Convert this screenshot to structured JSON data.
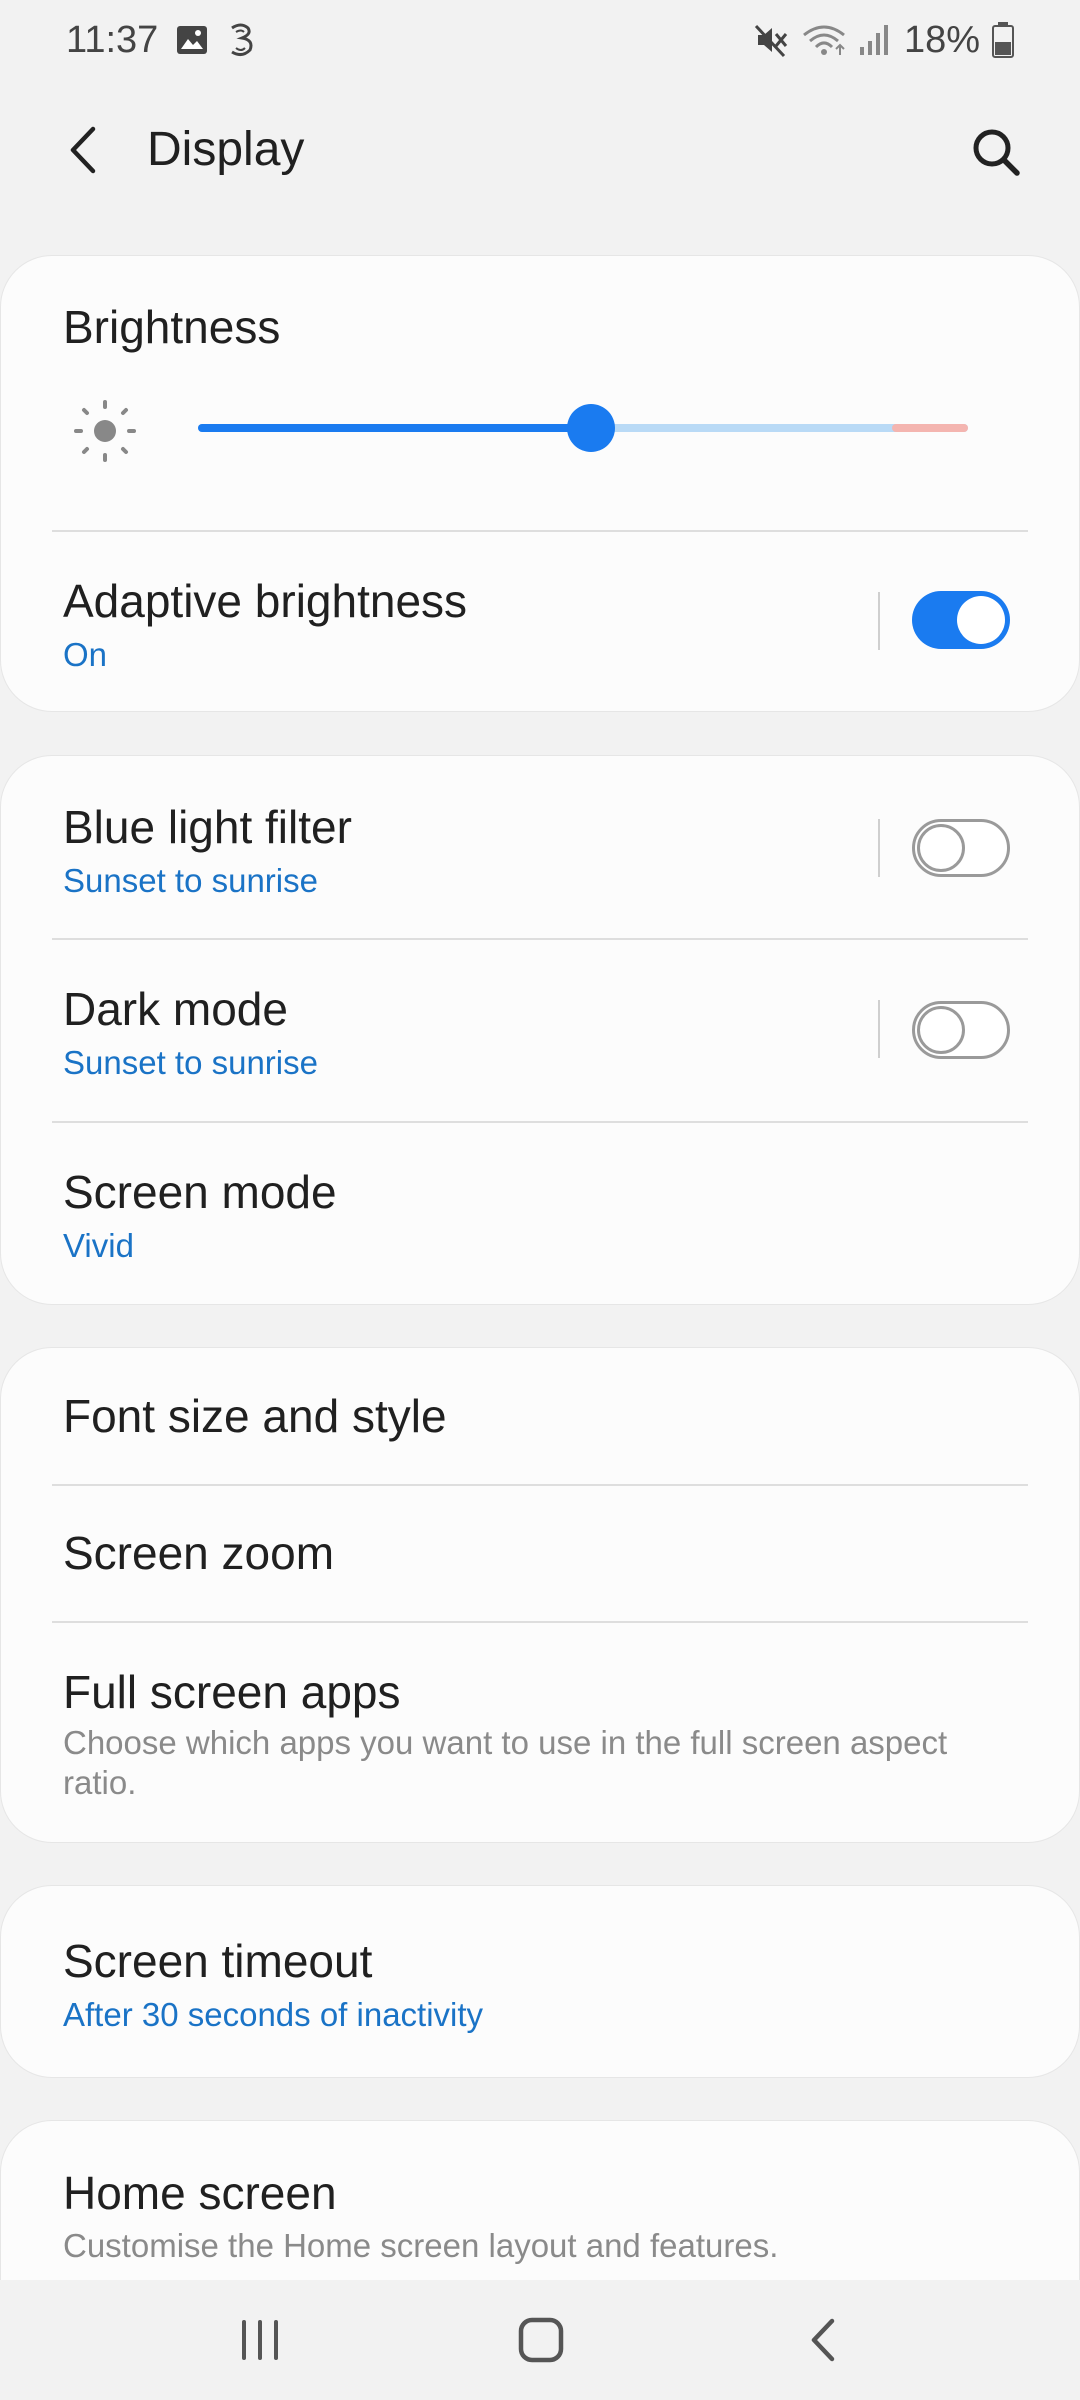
{
  "status_bar": {
    "time": "11:37",
    "battery": "18%",
    "icons": [
      "image-icon",
      "three-network-icon",
      "mute-icon",
      "wifi-icon",
      "signal-icon",
      "battery-icon"
    ]
  },
  "header": {
    "title": "Display",
    "back_icon": "chevron-left-icon",
    "search_icon": "search-icon"
  },
  "brightness": {
    "title": "Brightness",
    "icon": "sun-icon",
    "level": 0.51
  },
  "adaptive_brightness": {
    "title": "Adaptive brightness",
    "status": "On",
    "enabled": true
  },
  "blue_light_filter": {
    "title": "Blue light filter",
    "status": "Sunset to sunrise",
    "enabled": false
  },
  "dark_mode": {
    "title": "Dark mode",
    "status": "Sunset to sunrise",
    "enabled": false
  },
  "screen_mode": {
    "title": "Screen mode",
    "status": "Vivid"
  },
  "font_size": {
    "title": "Font size and style"
  },
  "screen_zoom": {
    "title": "Screen zoom"
  },
  "full_screen_apps": {
    "title": "Full screen apps",
    "description": "Choose which apps you want to use in the full screen aspect ratio."
  },
  "screen_timeout": {
    "title": "Screen timeout",
    "status": "After 30 seconds of inactivity"
  },
  "home_screen": {
    "title": "Home screen",
    "description": "Customise the Home screen layout and features."
  },
  "nav_bar": {
    "icons": [
      "recent-apps-icon",
      "home-icon",
      "back-icon"
    ]
  },
  "colors": {
    "accent": "#1a7bf0",
    "link": "#1a73c6",
    "background": "#f2f2f2",
    "card": "#fcfcfc"
  }
}
